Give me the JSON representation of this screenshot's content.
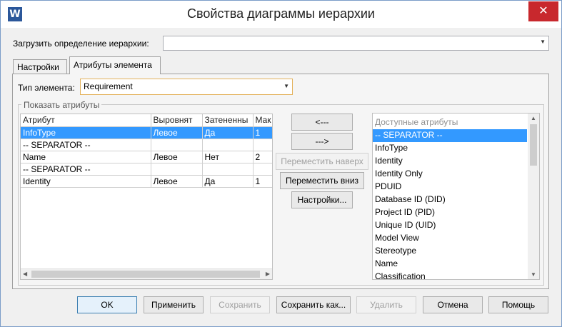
{
  "window": {
    "title": "Свойства диаграммы иерархии",
    "app_icon_letter": "W",
    "close_glyph": "✕"
  },
  "load_definition": {
    "label": "Загрузить определение иерархии:",
    "value": ""
  },
  "tabs": [
    {
      "label": "Настройки",
      "active": false
    },
    {
      "label": "Атрибуты элемента",
      "active": true
    }
  ],
  "element_type": {
    "label": "Тип элемента:",
    "value": "Requirement"
  },
  "show_attributes": {
    "group_label": "Показать атрибуты",
    "columns": [
      "Атрибут",
      "Выровнят",
      "Затененны",
      "Мак"
    ],
    "rows": [
      {
        "cells": [
          "InfoType",
          "Левое",
          "Да",
          "1"
        ],
        "selected": true
      },
      {
        "cells": [
          "-- SEPARATOR --",
          "",
          "",
          ""
        ],
        "selected": false
      },
      {
        "cells": [
          "Name",
          "Левое",
          "Нет",
          "2"
        ],
        "selected": false
      },
      {
        "cells": [
          "-- SEPARATOR --",
          "",
          "",
          ""
        ],
        "selected": false
      },
      {
        "cells": [
          "Identity",
          "Левое",
          "Да",
          "1"
        ],
        "selected": false
      }
    ]
  },
  "middle_buttons": {
    "add": "<---",
    "remove": "--->",
    "move_up": "Переместить наверх",
    "move_down": "Переместить вниз",
    "settings": "Настройки..."
  },
  "available": {
    "header": "Доступные атрибуты",
    "items": [
      "-- SEPARATOR --",
      "InfoType",
      "Identity",
      "Identity Only",
      "PDUID",
      "Database ID (DID)",
      "Project ID (PID)",
      "Unique ID (UID)",
      "Model View",
      "Stereotype",
      "Name",
      "Classification"
    ],
    "selected_index": 0
  },
  "footer": {
    "ok": "OK",
    "apply": "Применить",
    "save": "Сохранить",
    "save_as": "Сохранить как...",
    "delete": "Удалить",
    "cancel": "Отмена",
    "help": "Помощь"
  }
}
